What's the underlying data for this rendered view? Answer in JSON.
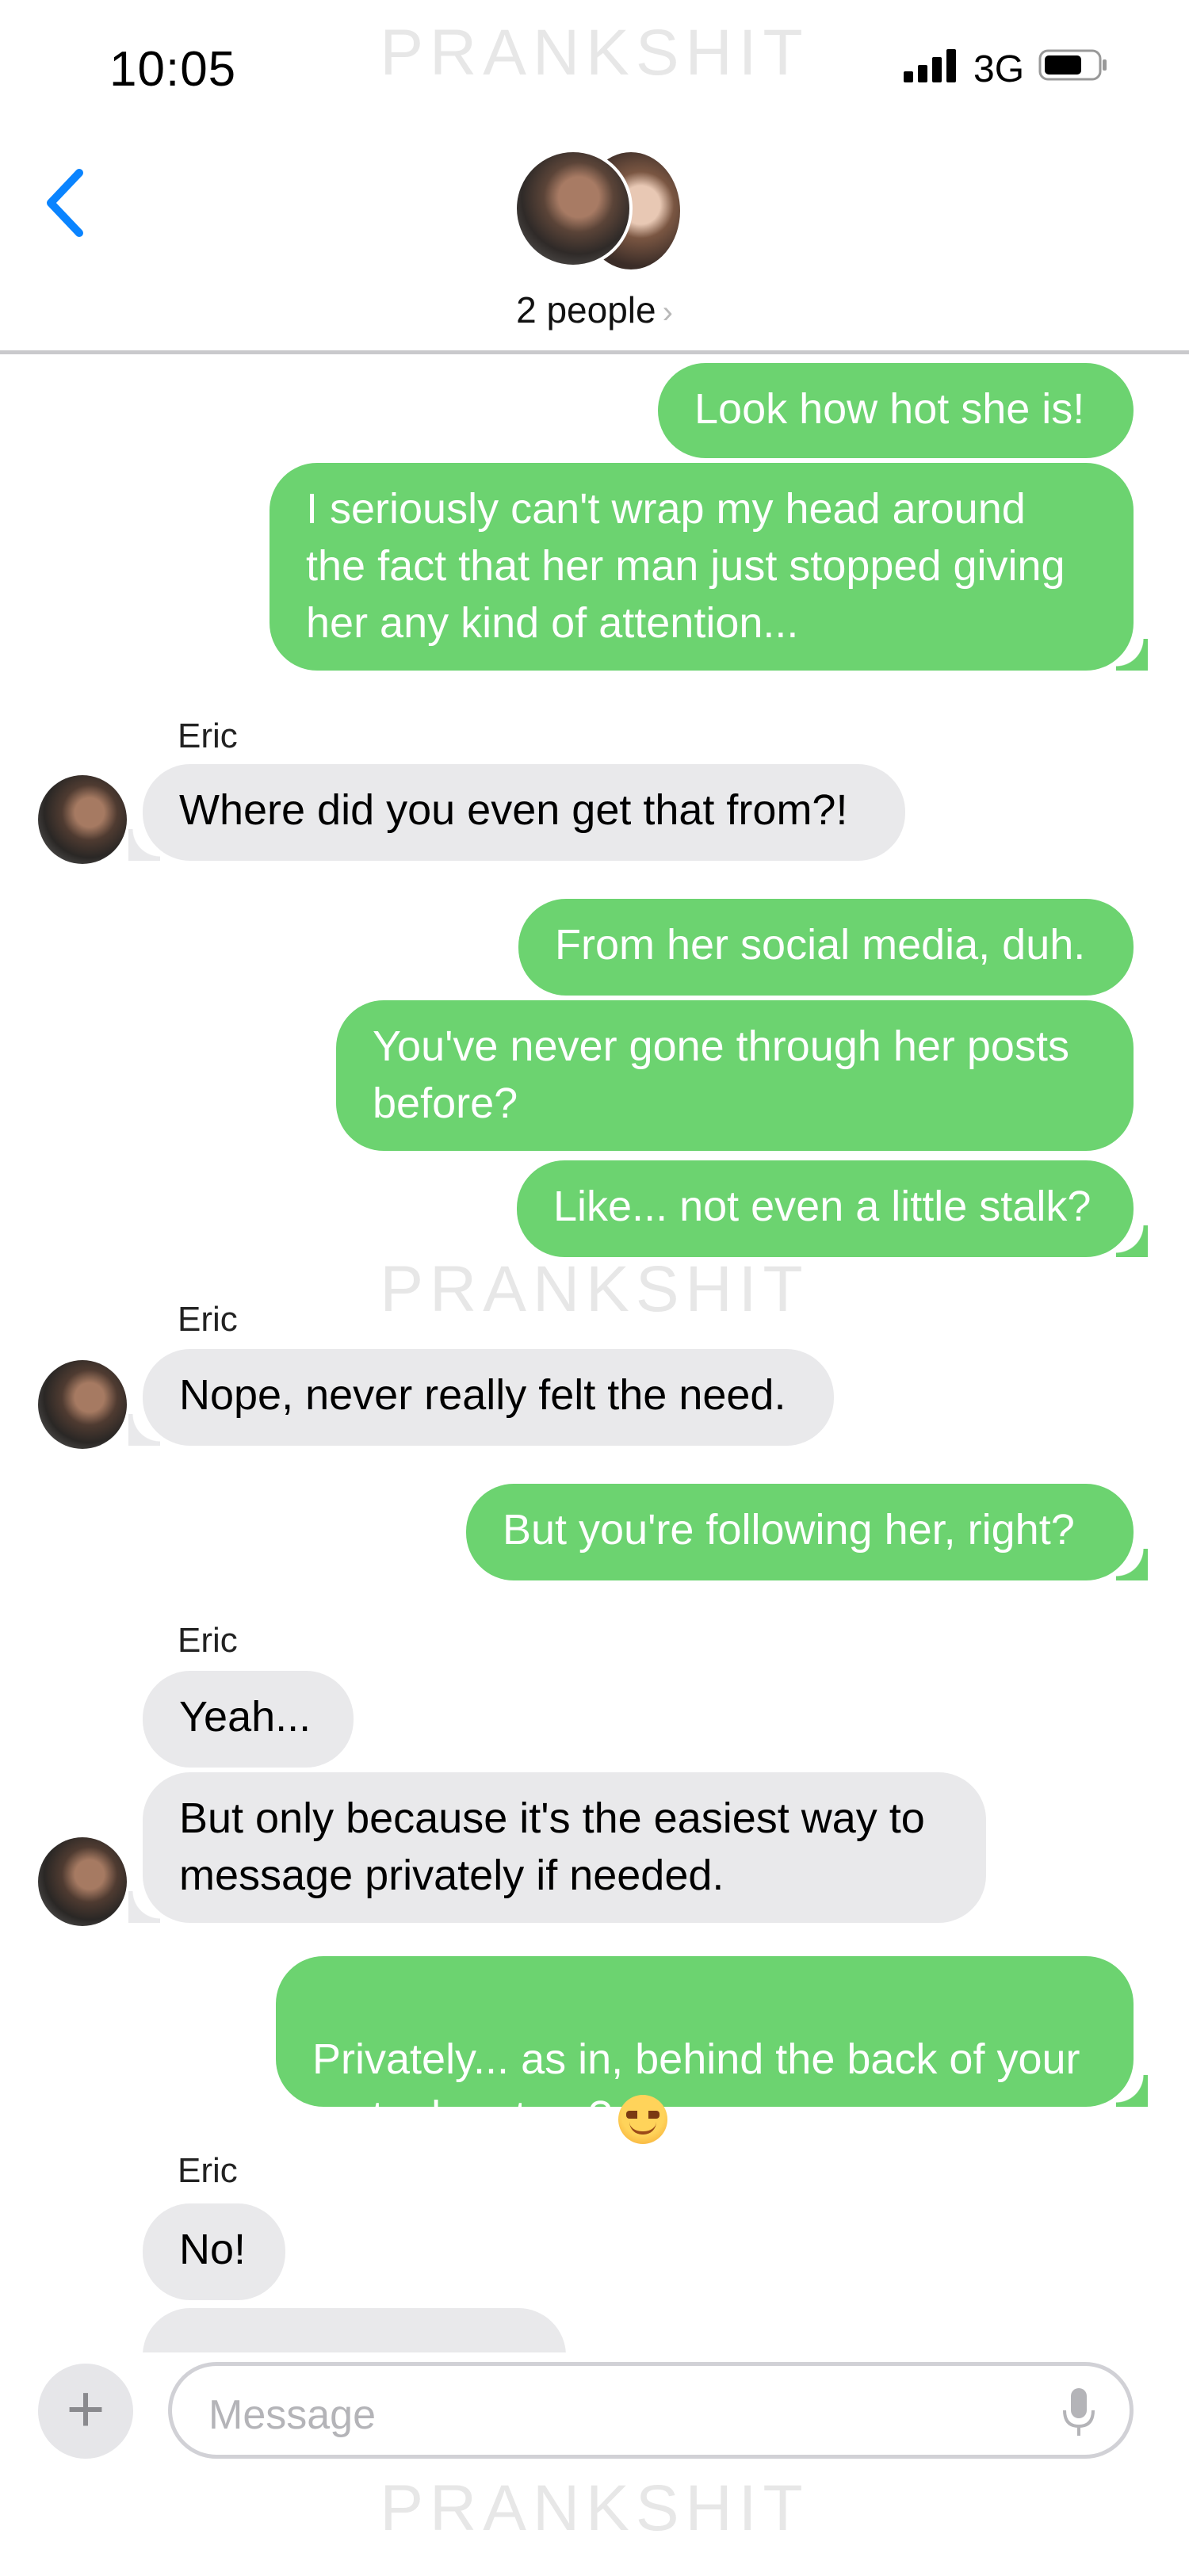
{
  "status_bar": {
    "time": "10:05",
    "network": "3G"
  },
  "watermark": "PRANKSHIT",
  "header": {
    "title": "2 people",
    "chevron": "›"
  },
  "contact_name": "Eric",
  "messages": [
    {
      "from": "me",
      "text": "Look how hot she is!"
    },
    {
      "from": "me",
      "text": "I seriously can't wrap my head around\nthe fact that her man just stopped giving\nher any kind of attention..."
    },
    {
      "from": "Eric",
      "text": "Where did you even get that from?!"
    },
    {
      "from": "me",
      "text": "From her social media, duh."
    },
    {
      "from": "me",
      "text": "You've never gone through her posts\nbefore?"
    },
    {
      "from": "me",
      "text": "Like... not even a little stalk?"
    },
    {
      "from": "Eric",
      "text": "Nope, never really felt the need."
    },
    {
      "from": "me",
      "text": "But you're following her, right?"
    },
    {
      "from": "Eric",
      "text": "Yeah..."
    },
    {
      "from": "Eric",
      "text": "But only because it's the easiest way to\nmessage privately if needed."
    },
    {
      "from": "me",
      "text": "Privately... as in, behind the back of your\nmutual partner?",
      "emoji": "relieved-face-emoji"
    },
    {
      "from": "Eric",
      "text": "No!"
    }
  ],
  "composer": {
    "placeholder": "Message",
    "plus": "+"
  },
  "colors": {
    "outgoing": "#6cd370",
    "incoming": "#e9e9eb",
    "accent": "#0a84ff"
  }
}
